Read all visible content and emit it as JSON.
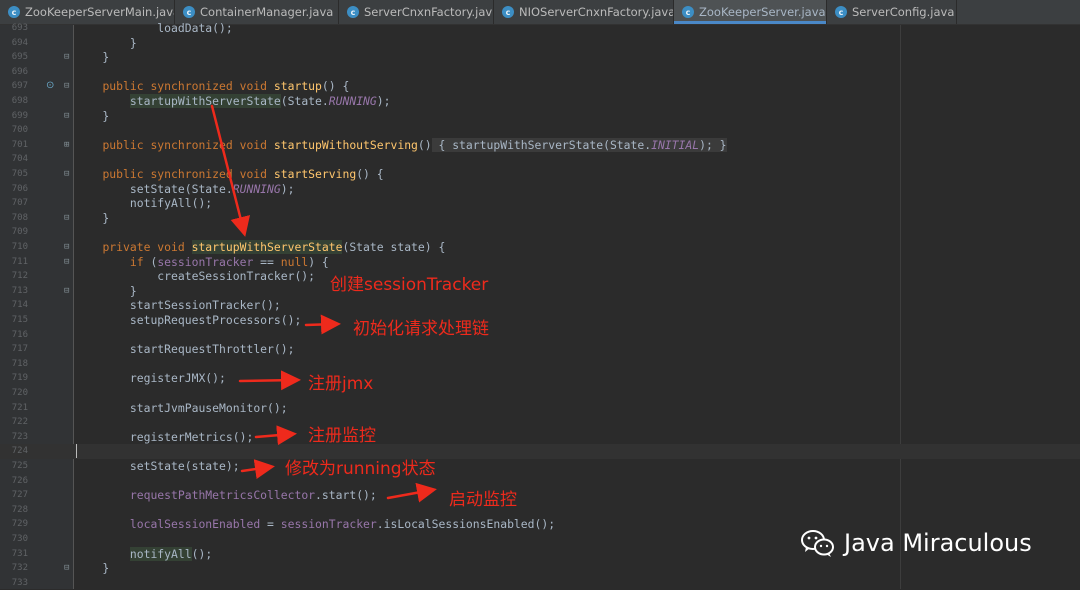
{
  "tabs": [
    {
      "label": "ZooKeeperServerMain.java",
      "active": false
    },
    {
      "label": "ContainerManager.java",
      "active": false
    },
    {
      "label": "ServerCnxnFactory.java",
      "active": false
    },
    {
      "label": "NIOServerCnxnFactory.java",
      "active": false
    },
    {
      "label": "ZooKeeperServer.java",
      "active": true
    },
    {
      "label": "ServerConfig.java",
      "active": false
    }
  ],
  "tab_close_glyph": "×",
  "file_icon_letter": "c",
  "line_numbers": [
    "693",
    "694",
    "695",
    "696",
    "697",
    "698",
    "699",
    "700",
    "701",
    "704",
    "705",
    "706",
    "707",
    "708",
    "709",
    "710",
    "711",
    "712",
    "713",
    "714",
    "715",
    "716",
    "717",
    "718",
    "719",
    "720",
    "721",
    "722",
    "723",
    "724",
    "725",
    "726",
    "727",
    "728",
    "729",
    "730",
    "731",
    "732",
    "733"
  ],
  "code": {
    "l693_call": "loadData",
    "l697_kw": "public synchronized void",
    "l697_method": "startup",
    "l698_call": "startupWithServerState",
    "l698_cls": "State.",
    "l698_const": "RUNNING",
    "l701_kw": "public synchronized void",
    "l701_method": "startupWithoutServing",
    "l701_call": "startupWithServerState",
    "l701_cls": "State.",
    "l701_const": "INITIAL",
    "l705_kw": "public synchronized void",
    "l705_method": "startServing",
    "l706_call": "setState(State.",
    "l706_const": "RUNNING",
    "l707_call": "notifyAll();",
    "l710_kw": "private void",
    "l710_method": "startupWithServerState",
    "l710_params": "(State state) {",
    "l711_kw1": "if",
    "l711_field": "sessionTracker",
    "l711_kw2": "null",
    "l712_call": "createSessionTracker();",
    "l714_call": "startSessionTracker();",
    "l715_call": "setupRequestProcessors();",
    "l717_call": "startRequestThrottler();",
    "l719_call": "registerJMX();",
    "l721_call": "startJvmPauseMonitor();",
    "l723_call": "registerMetrics();",
    "l725_call": "setState(state);",
    "l727_field": "requestPathMetricsCollector",
    "l727_rest": ".start();",
    "l729_field1": "localSessionEnabled",
    "l729_field2": "sessionTracker",
    "l729_rest": ".isLocalSessionsEnabled();",
    "l731_call": "notifyAll",
    "l731_rest": "();"
  },
  "annotations": {
    "create_session_tracker": "创建sessionTracker",
    "init_processor_chain": "初始化请求处理链",
    "register_jmx": "注册jmx",
    "register_metrics": "注册监控",
    "set_running": "修改为running状态",
    "start_metrics": "启动监控"
  },
  "watermark": "Java Miraculous",
  "colors": {
    "background": "#2b2b2b",
    "keyword": "#cc7832",
    "method_decl": "#ffc66d",
    "field": "#9876aa",
    "annotation_red": "#ee2a1c"
  }
}
